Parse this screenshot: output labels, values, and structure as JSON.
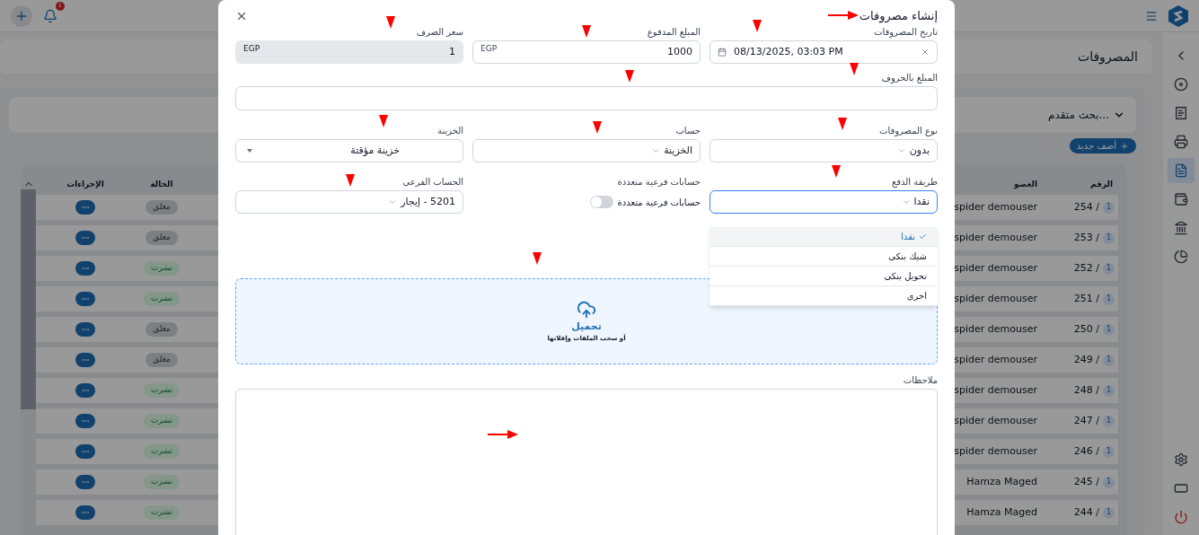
{
  "top_bar": {
    "notification_count": "٤"
  },
  "sidebar": {
    "items": [
      {
        "selected": false
      },
      {
        "selected": false
      },
      {
        "selected": false
      },
      {
        "selected": false
      },
      {
        "selected": true
      },
      {
        "selected": false
      },
      {
        "selected": false
      },
      {
        "selected": false
      }
    ]
  },
  "page_title": "المصروفات",
  "search": {
    "label": "بحث متقدم..."
  },
  "add_button": "أضف جديد",
  "table": {
    "columns": [
      "الرقم",
      "العضو",
      "الحالة",
      "الإجراءات"
    ],
    "rows": [
      {
        "status": "معلق",
        "kind": "pending",
        "member": "spider demouser",
        "number": "254 /",
        "badge": "1"
      },
      {
        "status": "معلق",
        "kind": "pending",
        "member": "spider demouser",
        "number": "253 /",
        "badge": "1"
      },
      {
        "status": "نشرت",
        "kind": "published",
        "member": "spider demouser",
        "number": "252 /",
        "badge": "1"
      },
      {
        "status": "نشرت",
        "kind": "published",
        "member": "spider demouser",
        "number": "251 /",
        "badge": "1"
      },
      {
        "status": "معلق",
        "kind": "pending",
        "member": "spider demouser",
        "number": "250 /",
        "badge": "1"
      },
      {
        "status": "معلق",
        "kind": "pending",
        "member": "spider demouser",
        "number": "249 /",
        "badge": "1"
      },
      {
        "status": "نشرت",
        "kind": "published",
        "member": "spider demouser",
        "number": "248 /",
        "badge": "1"
      },
      {
        "status": "نشرت",
        "kind": "published",
        "member": "spider demouser",
        "number": "247 /",
        "badge": "1"
      },
      {
        "status": "نشرت",
        "kind": "published",
        "member": "spider demouser",
        "number": "246 /",
        "badge": "1"
      },
      {
        "status": "نشرت",
        "kind": "published",
        "member": "Hamza Maged",
        "number": "245 /",
        "badge": "1"
      },
      {
        "status": "نشرت",
        "kind": "published",
        "member": "Hamza Maged",
        "number": "244 /",
        "badge": "1"
      }
    ]
  },
  "modal": {
    "title": "إنشاء مصروفات",
    "expense_date": {
      "label": "تاريخ المصروفات",
      "value": "08/13/2025, 03:03 PM"
    },
    "paid_amount": {
      "label": "المبلغ المدفوع",
      "value": "1000",
      "currency": "EGP"
    },
    "exchange_rate": {
      "label": "سعر الصرف",
      "value": "1",
      "currency": "EGP",
      "disabled": true
    },
    "amount_in_words": {
      "label": "المبلغ بالحروف"
    },
    "expense_type": {
      "label": "نوع المصروفات",
      "value": "بدون"
    },
    "account": {
      "label": "حساب",
      "value": "الخزينة"
    },
    "treasury": {
      "label": "الخزينة",
      "value": "خزينة مؤقتة"
    },
    "payment_method": {
      "label": "طريقة الدفع",
      "value": "نقدا",
      "expanded": true,
      "options": [
        {
          "label": "نقدا",
          "selected": true
        },
        {
          "label": "شيك بنكى",
          "selected": false
        },
        {
          "label": "تحويل بنكى",
          "selected": false
        },
        {
          "label": "اخرى",
          "selected": false
        }
      ]
    },
    "multi_sub_accounts": {
      "label": "حسابات فرعية متعددة",
      "toggle_label": "حسابات فرعية متعددة",
      "on": false
    },
    "sub_account": {
      "label": "الحساب الفرعى",
      "value": "5201 - إيجار"
    },
    "upload": {
      "title": "تحميل",
      "hint": "أو سحب الملفات وإفلاتها"
    },
    "notes": {
      "label": "ملاحظات"
    }
  }
}
